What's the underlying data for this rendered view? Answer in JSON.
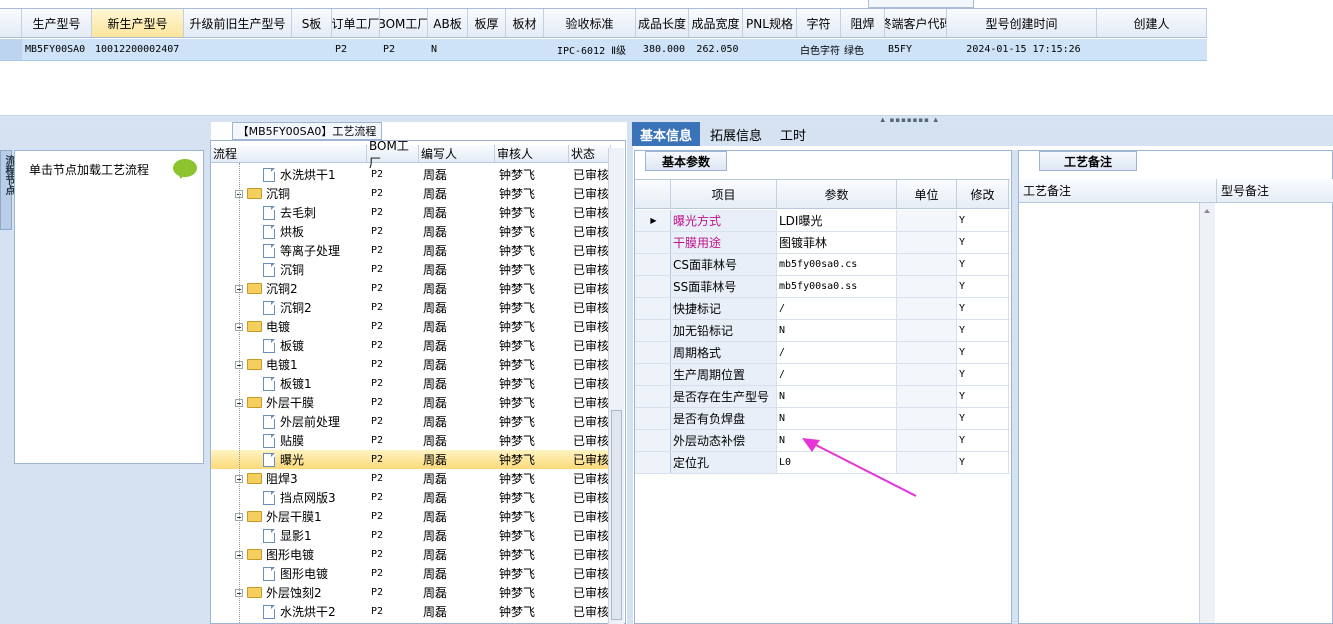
{
  "top_grid": {
    "columns": [
      "生产型号",
      "新生产型号",
      "升级前旧生产型号",
      "S板",
      "订单工厂",
      "BOM工厂",
      "AB板",
      "板厚",
      "板材",
      "验收标准",
      "成品长度",
      "成品宽度",
      "PNL规格",
      "字符",
      "阻焊",
      "终端客户代码",
      "型号创建时间",
      "创建人"
    ],
    "row": [
      "MB5FY00SA0",
      "10012200002407",
      "",
      "",
      "P2",
      "P2",
      "N",
      "",
      "",
      "IPC-6012 Ⅱ级",
      "380.000",
      "262.050",
      "",
      "白色字符",
      "绿色",
      "B5FY",
      "2024-01-15 17:15:26",
      ""
    ]
  },
  "left_panel": {
    "vertical_tab": "流程节点",
    "hint": "单击节点加载工艺流程"
  },
  "tree": {
    "title": "【MB5FY00SA0】工艺流程",
    "headers": [
      "流程",
      "BOM工厂",
      "编写人",
      "审核人",
      "状态"
    ],
    "rows": [
      {
        "name": "水洗烘干1",
        "type": "doc",
        "level": 2,
        "bom": "P2",
        "writer": "周磊",
        "reviewer": "钟梦飞",
        "status": "已审核"
      },
      {
        "name": "沉铜",
        "type": "folder",
        "level": 1,
        "bom": "P2",
        "writer": "周磊",
        "reviewer": "钟梦飞",
        "status": "已审核"
      },
      {
        "name": "去毛刺",
        "type": "doc",
        "level": 2,
        "bom": "P2",
        "writer": "周磊",
        "reviewer": "钟梦飞",
        "status": "已审核"
      },
      {
        "name": "烘板",
        "type": "doc",
        "level": 2,
        "bom": "P2",
        "writer": "周磊",
        "reviewer": "钟梦飞",
        "status": "已审核"
      },
      {
        "name": "等离子处理",
        "type": "doc",
        "level": 2,
        "bom": "P2",
        "writer": "周磊",
        "reviewer": "钟梦飞",
        "status": "已审核"
      },
      {
        "name": "沉铜",
        "type": "doc",
        "level": 2,
        "bom": "P2",
        "writer": "周磊",
        "reviewer": "钟梦飞",
        "status": "已审核"
      },
      {
        "name": "沉铜2",
        "type": "folder",
        "level": 1,
        "bom": "P2",
        "writer": "周磊",
        "reviewer": "钟梦飞",
        "status": "已审核"
      },
      {
        "name": "沉铜2",
        "type": "doc",
        "level": 2,
        "bom": "P2",
        "writer": "周磊",
        "reviewer": "钟梦飞",
        "status": "已审核"
      },
      {
        "name": "电镀",
        "type": "folder",
        "level": 1,
        "bom": "P2",
        "writer": "周磊",
        "reviewer": "钟梦飞",
        "status": "已审核"
      },
      {
        "name": "板镀",
        "type": "doc",
        "level": 2,
        "bom": "P2",
        "writer": "周磊",
        "reviewer": "钟梦飞",
        "status": "已审核"
      },
      {
        "name": "电镀1",
        "type": "folder",
        "level": 1,
        "bom": "P2",
        "writer": "周磊",
        "reviewer": "钟梦飞",
        "status": "已审核"
      },
      {
        "name": "板镀1",
        "type": "doc",
        "level": 2,
        "bom": "P2",
        "writer": "周磊",
        "reviewer": "钟梦飞",
        "status": "已审核"
      },
      {
        "name": "外层干膜",
        "type": "folder",
        "level": 1,
        "bom": "P2",
        "writer": "周磊",
        "reviewer": "钟梦飞",
        "status": "已审核"
      },
      {
        "name": "外层前处理",
        "type": "doc",
        "level": 2,
        "bom": "P2",
        "writer": "周磊",
        "reviewer": "钟梦飞",
        "status": "已审核"
      },
      {
        "name": "贴膜",
        "type": "doc",
        "level": 2,
        "bom": "P2",
        "writer": "周磊",
        "reviewer": "钟梦飞",
        "status": "已审核"
      },
      {
        "name": "曝光",
        "type": "doc",
        "level": 2,
        "bom": "P2",
        "writer": "周磊",
        "reviewer": "钟梦飞",
        "status": "已审核",
        "selected": true
      },
      {
        "name": "阻焊3",
        "type": "folder",
        "level": 1,
        "bom": "P2",
        "writer": "周磊",
        "reviewer": "钟梦飞",
        "status": "已审核"
      },
      {
        "name": "挡点网版3",
        "type": "doc",
        "level": 2,
        "bom": "P2",
        "writer": "周磊",
        "reviewer": "钟梦飞",
        "status": "已审核"
      },
      {
        "name": "外层干膜1",
        "type": "folder",
        "level": 1,
        "bom": "P2",
        "writer": "周磊",
        "reviewer": "钟梦飞",
        "status": "已审核"
      },
      {
        "name": "显影1",
        "type": "doc",
        "level": 2,
        "bom": "P2",
        "writer": "周磊",
        "reviewer": "钟梦飞",
        "status": "已审核"
      },
      {
        "name": "图形电镀",
        "type": "folder",
        "level": 1,
        "bom": "P2",
        "writer": "周磊",
        "reviewer": "钟梦飞",
        "status": "已审核"
      },
      {
        "name": "图形电镀",
        "type": "doc",
        "level": 2,
        "bom": "P2",
        "writer": "周磊",
        "reviewer": "钟梦飞",
        "status": "已审核"
      },
      {
        "name": "外层蚀刻2",
        "type": "folder",
        "level": 1,
        "bom": "P2",
        "writer": "周磊",
        "reviewer": "钟梦飞",
        "status": "已审核"
      },
      {
        "name": "水洗烘干2",
        "type": "doc",
        "level": 2,
        "bom": "P2",
        "writer": "周磊",
        "reviewer": "钟梦飞",
        "status": "已审核"
      }
    ]
  },
  "tabs": [
    "基本信息",
    "拓展信息",
    "工时"
  ],
  "basic": {
    "panel_tab": "基本参数",
    "headers": [
      "项目",
      "参数",
      "单位",
      "修改"
    ],
    "rows": [
      {
        "item": "曝光方式",
        "param": "LDI曝光",
        "unit": "",
        "edit": "Y",
        "pink": true,
        "current": true
      },
      {
        "item": "干膜用途",
        "param": "图镀菲林",
        "unit": "",
        "edit": "Y",
        "pink": true
      },
      {
        "item": "CS面菲林号",
        "param": "mb5fy00sa0.cs",
        "unit": "",
        "edit": "Y"
      },
      {
        "item": "SS面菲林号",
        "param": "mb5fy00sa0.ss",
        "unit": "",
        "edit": "Y"
      },
      {
        "item": "快捷标记",
        "param": "/",
        "unit": "",
        "edit": "Y"
      },
      {
        "item": "加无铅标记",
        "param": "N",
        "unit": "",
        "edit": "Y"
      },
      {
        "item": "周期格式",
        "param": "/",
        "unit": "",
        "edit": "Y"
      },
      {
        "item": "生产周期位置",
        "param": "/",
        "unit": "",
        "edit": "Y"
      },
      {
        "item": "是否存在生产型号",
        "param": "N",
        "unit": "",
        "edit": "Y"
      },
      {
        "item": "是否有负焊盘",
        "param": "N",
        "unit": "",
        "edit": "Y"
      },
      {
        "item": "外层动态补偿",
        "param": "N",
        "unit": "",
        "edit": "Y"
      },
      {
        "item": "定位孔",
        "param": "L0",
        "unit": "",
        "edit": "Y"
      }
    ]
  },
  "remark": {
    "panel_tab": "工艺备注",
    "headers": [
      "工艺备注",
      "型号备注"
    ]
  },
  "colors": {
    "tab_active": "#3a73b8",
    "arrow": "#e733d8",
    "pink_text": "#c0128b",
    "selection": "#fbd97a"
  }
}
